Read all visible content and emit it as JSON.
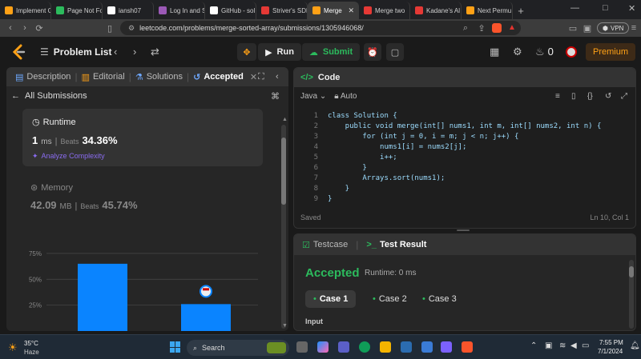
{
  "browser": {
    "tabs": [
      {
        "label": "Implement C",
        "color": "#ffa116",
        "active": false
      },
      {
        "label": "Page Not Fo",
        "color": "#2cbb5d",
        "active": false
      },
      {
        "label": "iansh07",
        "color": "#ffffff",
        "active": false
      },
      {
        "label": "Log In and S",
        "color": "#9b59b6",
        "active": false
      },
      {
        "label": "GitHub - sol",
        "color": "#ffffff",
        "active": false
      },
      {
        "label": "Striver's SDE",
        "color": "#e53935",
        "active": false
      },
      {
        "label": "Merge",
        "color": "#ffa116",
        "active": true
      },
      {
        "label": "Merge two",
        "color": "#e53935",
        "active": false
      },
      {
        "label": "Kadane's Al",
        "color": "#e53935",
        "active": false
      },
      {
        "label": "Next Permu",
        "color": "#ffa116",
        "active": false
      }
    ],
    "close_glyph": "✕",
    "new_tab": "+",
    "url": "leetcode.com/problems/merge-sorted-array/submissions/1305946068/",
    "vpn": "VPN"
  },
  "header": {
    "problem_list": "Problem List",
    "run": "Run",
    "submit": "Submit",
    "streak": "0",
    "premium": "Premium"
  },
  "left_panel": {
    "tabs": {
      "description": "Description",
      "editorial": "Editorial",
      "solutions": "Solutions",
      "accepted": "Accepted"
    },
    "all_submissions": "All Submissions",
    "runtime": {
      "title": "Runtime",
      "value": "1",
      "unit": "ms",
      "beats_label": "Beats",
      "beats": "34.36%",
      "analyze": "Analyze Complexity"
    },
    "memory": {
      "title": "Memory",
      "value": "42.09",
      "unit": "MB",
      "beats_label": "Beats",
      "beats": "45.74%"
    }
  },
  "chart_data": {
    "type": "bar",
    "yticks": [
      "75%",
      "50%",
      "25%"
    ],
    "ylim": [
      0,
      85
    ],
    "values": [
      65,
      26
    ],
    "colors": [
      "#0a84ff",
      "#0a84ff"
    ]
  },
  "code_panel": {
    "title": "Code",
    "language": "Java",
    "auto": "Auto",
    "lines": [
      "class Solution {",
      "    public void merge(int[] nums1, int m, int[] nums2, int n) {",
      "        for (int j = 0, i = m; j < n; j++) {",
      "            nums1[i] = nums2[j];",
      "            i++;",
      "        }",
      "        Arrays.sort(nums1);",
      "    }",
      "}"
    ],
    "line_numbers": [
      "1",
      "2",
      "3",
      "4",
      "5",
      "6",
      "7",
      "8",
      "9"
    ],
    "status": "Saved",
    "position": "Ln 10, Col 1"
  },
  "result_panel": {
    "testcase": "Testcase",
    "test_result": "Test Result",
    "verdict": "Accepted",
    "runtime": "Runtime: 0 ms",
    "cases": [
      "Case 1",
      "Case 2",
      "Case 3"
    ],
    "input_label": "Input"
  },
  "taskbar": {
    "temp": "35°C",
    "weather": "Haze",
    "search": "Search",
    "time": "7:55 PM",
    "date": "7/1/2024"
  }
}
